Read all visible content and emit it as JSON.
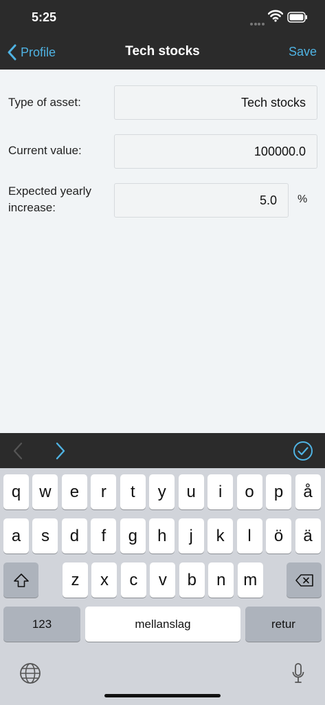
{
  "status_bar": {
    "time": "5:25"
  },
  "nav": {
    "back_label": "Profile",
    "title": "Tech stocks",
    "save_label": "Save"
  },
  "form": {
    "type_label": "Type of asset:",
    "type_value": "Tech stocks",
    "current_label": "Current value:",
    "current_value": "100000.0",
    "increase_label_line1": "Expected yearly",
    "increase_label_line2": "increase:",
    "increase_value": "5.0",
    "increase_unit": "%"
  },
  "keyboard": {
    "row1": [
      "q",
      "w",
      "e",
      "r",
      "t",
      "y",
      "u",
      "i",
      "o",
      "p",
      "å"
    ],
    "row2": [
      "a",
      "s",
      "d",
      "f",
      "g",
      "h",
      "j",
      "k",
      "l",
      "ö",
      "ä"
    ],
    "row3": [
      "z",
      "x",
      "c",
      "v",
      "b",
      "n",
      "m"
    ],
    "numbers_label": "123",
    "space_label": "mellanslag",
    "return_label": "retur"
  },
  "colors": {
    "accent": "#4fb3e3",
    "bar": "#2b2b2b",
    "background": "#f1f4f6"
  }
}
